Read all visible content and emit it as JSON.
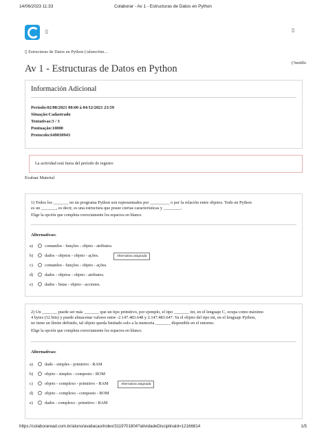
{
  "print": {
    "date": "14/06/2023 11:33",
    "title": "Colaborar - Av 1 - Estructuras de Datos en Python",
    "url": "https://colaboraread.com.br/aluno/avaliacao/index/3119701804?atividadeDisciplinaId=12166814",
    "page": "1/5"
  },
  "topbar": {
    "menu_glyph": "▯",
    "right_glyph": "▯",
    "notif": "(?notific"
  },
  "breadcrumb": "▯ Estructuras de Datos en Python (/aluno/tim…",
  "page_title": "Av 1 - Estructuras de Datos en Python",
  "info": {
    "heading": "Información Adicional",
    "periodo": "Período:02/08/2021 00:00 à 04/12/2021 23:59",
    "situacao": "Situação:Cadastrado",
    "tentativas": "Tentativas:3 / 3",
    "pontuacao": "Pontuação:10000",
    "protocolo": "Protocolo:649030943"
  },
  "notice": "La actividad está fuera del período de registro",
  "eval_material": "Evaluar Material",
  "alternativas_label": "Alternativas:",
  "questions": [
    {
      "line1": "1)  Todos  los  _______  en  un  programa  Python  son  representados  por  _________  o  por  la  relación  entre  objetos.  Todo  en  Python",
      "line2": "es un _______, es decir, es una estructura que posee ciertas características y ________.",
      "instruction": "Elige la opción que completa correctamente los espacios en blanco.",
      "options": [
        {
          "letter": "a)",
          "text": "comandos - funções - objeto - atributos."
        },
        {
          "letter": "b)",
          "text": "dados - objetos - objeto - ações."
        },
        {
          "letter": "c)",
          "text": "comandos - funções - objeto - ações."
        },
        {
          "letter": "d)",
          "text": "dados - objetos - objeto - atributos."
        },
        {
          "letter": "e)",
          "text": "dados - listas - objeto - acciones."
        }
      ],
      "badge": "Alternativa asignada"
    },
    {
      "line1": "2)  Un  _______  puede  ser  más  _______  que  un  tipo  primitivo,  por  ejemplo,  el  tipo  _______  int,  en  el  lenguaje  C,  ocupa  como  máximo",
      "line2": "4 bytes (32 bits) y puede almacenar valores entre -2.147.483.648 y 2.147.483.647. Ya el objeto del tipo int, en el lenguaje Python,",
      "line3": "no tiene un límite definido, tal objeto queda limitado solo a la memoria _______ disponible en el entorno.",
      "instruction": "Elige la opción que completa correctamente los espacios en blanco.",
      "options": [
        {
          "letter": "a)",
          "text": "dado - simples - primitivo - RAM"
        },
        {
          "letter": "b)",
          "text": "objeto - simples - composto - ROM"
        },
        {
          "letter": "c)",
          "text": "objeto - complexo - primitivo - RAM"
        },
        {
          "letter": "d)",
          "text": "objeto - complexo - composto - ROM"
        },
        {
          "letter": "e)",
          "text": "dados - complexo - primitivo - RAM"
        }
      ],
      "badge": "Alternativa asignada"
    }
  ]
}
